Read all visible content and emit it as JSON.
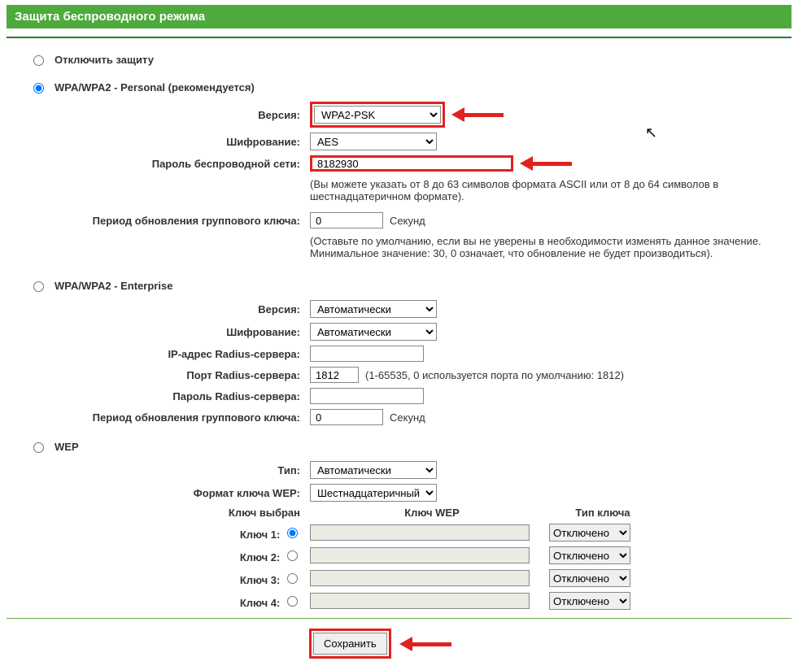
{
  "header": {
    "title": "Защита беспроводного режима"
  },
  "security": {
    "disable_label": "Отключить защиту",
    "selected_mode": "wpa_personal",
    "wpa_personal": {
      "title": "WPA/WPA2 - Personal (рекомендуется)",
      "version_label": "Версия:",
      "version_value": "WPA2-PSK",
      "encryption_label": "Шифрование:",
      "encryption_value": "AES",
      "password_label": "Пароль беспроводной сети:",
      "password_value": "8182930",
      "password_hint": "(Вы можете указать от 8 до 63 символов формата ASCII или от 8 до 64 символов в шестнадцатеричном формате).",
      "group_key_label": "Период обновления группового ключа:",
      "group_key_value": "0",
      "group_key_unit": "Секунд",
      "group_key_hint": "(Оставьте по умолчанию, если вы не уверены в необходимости изменять данное значение. Минимальное значение: 30, 0 означает, что обновление не будет производиться)."
    },
    "wpa_enterprise": {
      "title": "WPA/WPA2 - Enterprise",
      "version_label": "Версия:",
      "version_value": "Автоматически",
      "encryption_label": "Шифрование:",
      "encryption_value": "Автоматически",
      "radius_ip_label": "IP-адрес Radius-сервера:",
      "radius_ip_value": "",
      "radius_port_label": "Порт Radius-сервера:",
      "radius_port_value": "1812",
      "radius_port_hint": "(1-65535, 0 используется порта по умолчанию: 1812)",
      "radius_password_label": "Пароль Radius-сервера:",
      "radius_password_value": "",
      "group_key_label": "Период обновления группового ключа:",
      "group_key_value": "0",
      "group_key_unit": "Секунд"
    },
    "wep": {
      "title": "WEP",
      "type_label": "Тип:",
      "type_value": "Автоматически",
      "format_label": "Формат ключа WEP:",
      "format_value": "Шестнадцатеричный",
      "col_selected": "Ключ выбран",
      "col_key": "Ключ WEP",
      "col_type": "Тип ключа",
      "keys": [
        {
          "label": "Ключ 1:",
          "value": "",
          "type": "Отключено",
          "selected": true
        },
        {
          "label": "Ключ 2:",
          "value": "",
          "type": "Отключено",
          "selected": false
        },
        {
          "label": "Ключ 3:",
          "value": "",
          "type": "Отключено",
          "selected": false
        },
        {
          "label": "Ключ 4:",
          "value": "",
          "type": "Отключено",
          "selected": false
        }
      ]
    }
  },
  "buttons": {
    "save": "Сохранить"
  }
}
